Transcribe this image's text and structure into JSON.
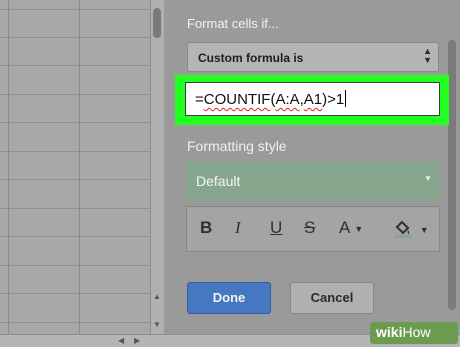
{
  "panel": {
    "format_label": "Format cells if...",
    "condition": {
      "selected": "Custom formula is"
    },
    "formula": {
      "prefix": "=",
      "fn_name": "COUNTIF",
      "args_open": "(",
      "arg1": "A:A",
      "comma": ",",
      "arg2": "A1",
      "suffix": ")>1"
    },
    "formatting_style_label": "Formatting style",
    "style": {
      "selected": "Default",
      "preview_color": "#86a78d"
    },
    "toolbar": {
      "bold": "B",
      "italic": "I",
      "underline": "U",
      "strikethrough": "S",
      "text_color": "A"
    },
    "done_label": "Done",
    "cancel_label": "Cancel"
  },
  "colors": {
    "highlight": "#22ff22",
    "done_button": "#4578c0"
  },
  "watermark": {
    "bold": "wiki",
    "light": "How"
  }
}
